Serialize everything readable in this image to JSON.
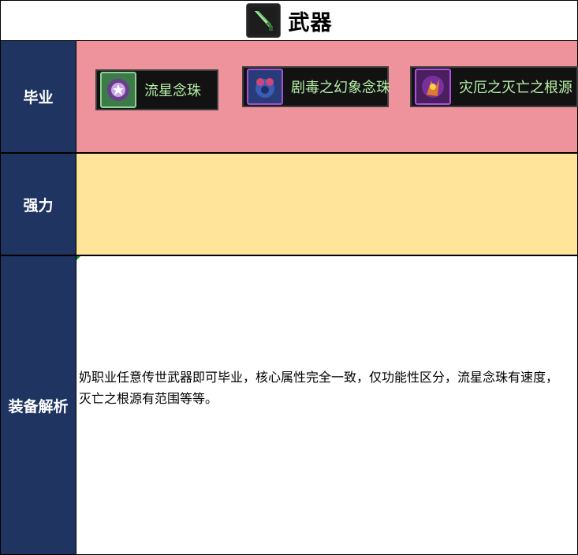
{
  "header": {
    "title": "武器",
    "icon": "sword-icon"
  },
  "rows": {
    "graduation": {
      "label": "毕业",
      "color": "#ee939c",
      "items": [
        {
          "name": "流星念珠",
          "icon": "rosary-orb-icon"
        },
        {
          "name": "剧毒之幻象念珠",
          "icon": "rosary-venom-icon"
        },
        {
          "name": "灾厄之灭亡之根源",
          "icon": "doom-root-icon"
        }
      ]
    },
    "strong": {
      "label": "强力",
      "color": "#ffe499"
    },
    "analysis": {
      "label": "装备解析",
      "text": "奶职业任意传世武器即可毕业，核心属性完全一致，仅功能性区分，流星念珠有速度，灭亡之根源有范围等等。"
    }
  },
  "colors": {
    "label_bg": "#1f3461",
    "item_text": "#b6f0a7"
  }
}
